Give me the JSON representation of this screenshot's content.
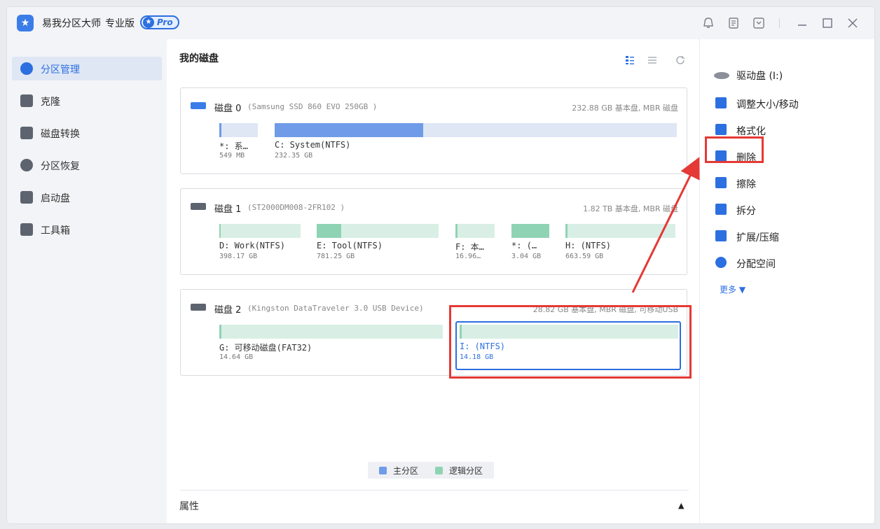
{
  "app": {
    "title": "易我分区大师",
    "edition": "专业版",
    "badge": "Pro"
  },
  "sidebar": {
    "items": [
      {
        "label": "分区管理",
        "icon": "pie-chart-icon",
        "active": true
      },
      {
        "label": "克隆",
        "icon": "clone-icon",
        "active": false
      },
      {
        "label": "磁盘转换",
        "icon": "convert-icon",
        "active": false
      },
      {
        "label": "分区恢复",
        "icon": "recovery-icon",
        "active": false
      },
      {
        "label": "启动盘",
        "icon": "boot-disk-icon",
        "active": false
      },
      {
        "label": "工具箱",
        "icon": "toolbox-icon",
        "active": false
      }
    ]
  },
  "main": {
    "title": "我的磁盘",
    "disks": [
      {
        "name": "磁盘 0",
        "model": "(Samsung SSD 860 EVO 250GB )",
        "info": "232.88 GB 基本盘, MBR 磁盘",
        "partitions": [
          {
            "label": "*: 系…",
            "size": "549 MB",
            "type": "primary",
            "fill": 0.05
          },
          {
            "label": "C: System(NTFS)",
            "size": "232.35 GB",
            "type": "primary",
            "fill": 0.37
          }
        ]
      },
      {
        "name": "磁盘 1",
        "model": "(ST2000DM008-2FR102 )",
        "info": "1.82 TB 基本盘, MBR 磁盘",
        "partitions": [
          {
            "label": "D: Work(NTFS)",
            "size": "398.17 GB",
            "type": "logical",
            "fill": 0.02
          },
          {
            "label": "E: Tool(NTFS)",
            "size": "781.25 GB",
            "type": "logical",
            "fill": 0.2
          },
          {
            "label": "F: 本…",
            "size": "16.96…",
            "type": "logical",
            "fill": 0.05
          },
          {
            "label": "*: (…",
            "size": "3.04 GB",
            "type": "logical",
            "fill": 1.0
          },
          {
            "label": "H: (NTFS)",
            "size": "663.59 GB",
            "type": "logical",
            "fill": 0.02
          }
        ]
      },
      {
        "name": "磁盘 2",
        "model": "(Kingston DataTraveler 3.0 USB Device)",
        "info": "28.82 GB 基本盘, MBR 磁盘, 可移动USB",
        "partitions": [
          {
            "label": "G: 可移动磁盘(FAT32)",
            "size": "14.64 GB",
            "type": "logical",
            "fill": 0.01
          },
          {
            "label": "I: (NTFS)",
            "size": "14.18 GB",
            "type": "logical",
            "fill": 0.01,
            "selected": true
          }
        ]
      }
    ],
    "legend": {
      "primary": "主分区",
      "logical": "逻辑分区"
    },
    "properties": "属性"
  },
  "operations": {
    "items": [
      {
        "label": "驱动盘 (I:)",
        "icon": "drive-icon"
      },
      {
        "label": "调整大小/移动",
        "icon": "resize-icon"
      },
      {
        "label": "格式化",
        "icon": "format-icon"
      },
      {
        "label": "删除",
        "icon": "trash-icon"
      },
      {
        "label": "擦除",
        "icon": "eraser-icon"
      },
      {
        "label": "拆分",
        "icon": "split-icon"
      },
      {
        "label": "扩展/压缩",
        "icon": "extend-icon"
      },
      {
        "label": "分配空间",
        "icon": "allocate-icon"
      }
    ],
    "more": "更多 ▼"
  },
  "colors": {
    "accent": "#2c6fe0",
    "primary_partition": "#6f9be8",
    "logical_partition": "#8fd3b5",
    "highlight": "#e53935"
  }
}
